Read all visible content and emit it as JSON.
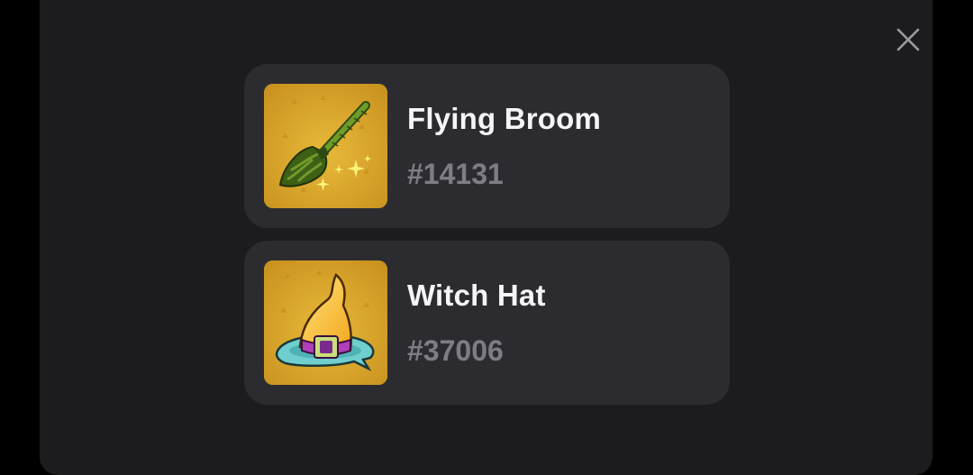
{
  "close_icon": "close-icon",
  "items": [
    {
      "name": "Flying Broom",
      "number": "#14131",
      "icon": "flying-broom-icon"
    },
    {
      "name": "Witch Hat",
      "number": "#37006",
      "icon": "witch-hat-icon"
    }
  ],
  "colors": {
    "page_background": "#000000",
    "modal_background": "#1c1c1e",
    "card_background": "#2c2c30",
    "item_name": "#f5f5f7",
    "item_number": "#7d7d83",
    "thumbnail_background": "#d9a52b"
  }
}
